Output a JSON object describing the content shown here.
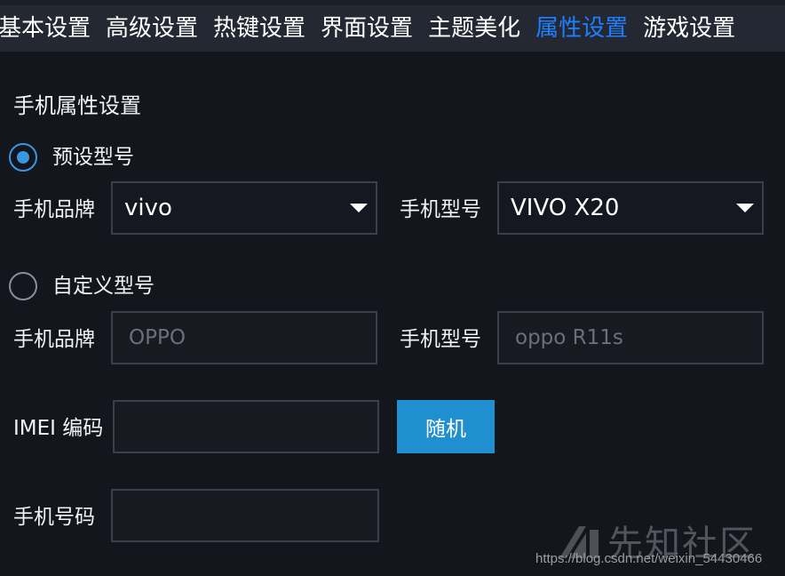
{
  "tabs": [
    {
      "label": "基本设置",
      "active": false
    },
    {
      "label": "高级设置",
      "active": false
    },
    {
      "label": "热键设置",
      "active": false
    },
    {
      "label": "界面设置",
      "active": false
    },
    {
      "label": "主题美化",
      "active": false
    },
    {
      "label": "属性设置",
      "active": true
    },
    {
      "label": "游戏设置",
      "active": false
    }
  ],
  "section_title": "手机属性设置",
  "preset": {
    "radio_label": "预设型号",
    "selected": true,
    "brand_label": "手机品牌",
    "brand_value": "vivo",
    "model_label": "手机型号",
    "model_value": "VIVO X20"
  },
  "custom": {
    "radio_label": "自定义型号",
    "selected": false,
    "brand_label": "手机品牌",
    "brand_placeholder": "OPPO",
    "model_label": "手机型号",
    "model_placeholder": "oppo R11s"
  },
  "imei": {
    "label": "IMEI 编码",
    "value": "",
    "random_button": "随机"
  },
  "phone_number": {
    "label": "手机号码",
    "value": ""
  },
  "watermark": {
    "brand": "先知社区",
    "url": "https://blog.csdn.net/weixin_54430466"
  },
  "colors": {
    "active_tab": "#1e7fff",
    "accent": "#3a97df",
    "button": "#1f8fd0",
    "background": "#13161d"
  }
}
